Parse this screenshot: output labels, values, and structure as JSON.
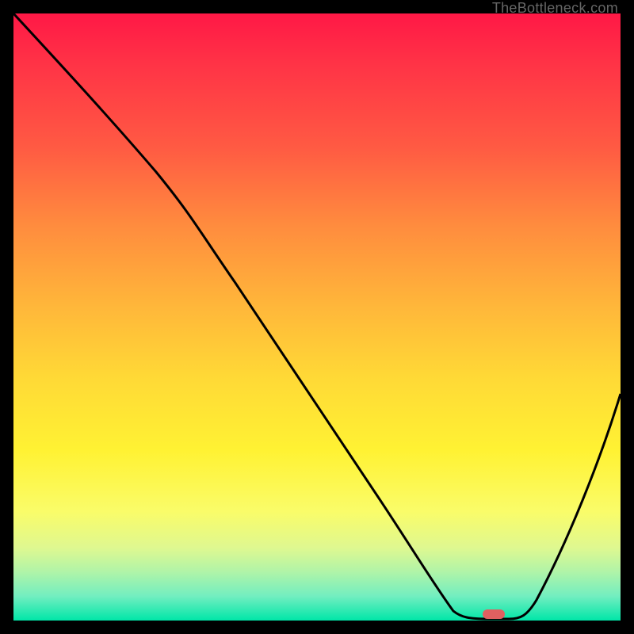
{
  "watermark": "TheBottleneck.com",
  "chart_data": {
    "type": "line",
    "title": "",
    "xlabel": "",
    "ylabel": "",
    "xlim": [
      0,
      100
    ],
    "ylim": [
      0,
      100
    ],
    "grid": false,
    "series": [
      {
        "name": "bottleneck-curve",
        "x": [
          0,
          10,
          20,
          30,
          40,
          50,
          60,
          65,
          70,
          74,
          80,
          90,
          100
        ],
        "y": [
          100,
          90,
          80,
          68,
          52,
          36,
          20,
          12,
          4,
          0,
          0,
          22,
          42
        ]
      }
    ],
    "marker": {
      "x": 78,
      "y": 0,
      "color": "#e06060"
    },
    "gradient_colors": {
      "top": "#ff1846",
      "mid": "#fff233",
      "bottom": "#00e6a8"
    }
  }
}
